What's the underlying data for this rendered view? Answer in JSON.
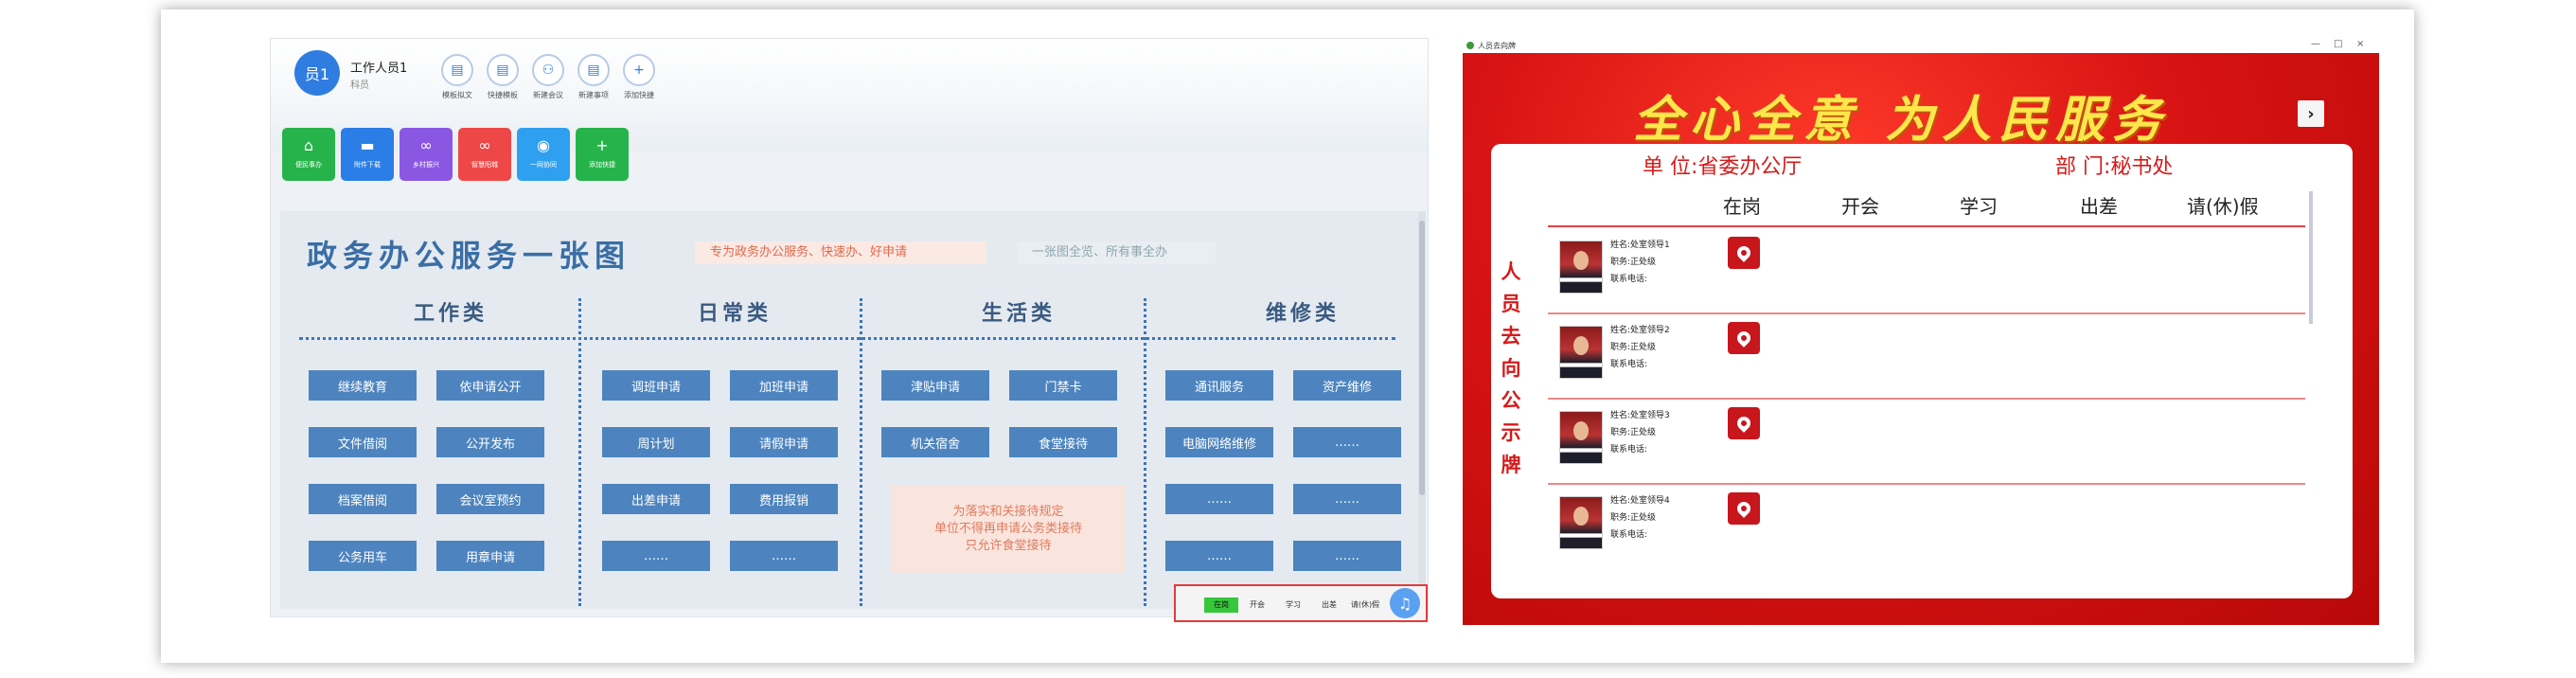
{
  "left": {
    "user": {
      "avatar": "员1",
      "name": "工作人员1",
      "dept": "科员"
    },
    "quick_actions": [
      {
        "label": "模板拟文",
        "icon": "doc-icon"
      },
      {
        "label": "快捷模板",
        "icon": "doc-icon"
      },
      {
        "label": "新建会议",
        "icon": "meeting-icon"
      },
      {
        "label": "新建事项",
        "icon": "doc-icon"
      },
      {
        "label": "添加快捷",
        "icon": "plus-icon"
      }
    ],
    "tiles": [
      {
        "label": "便民事办",
        "color": "#27b34b",
        "icon": "basket-icon"
      },
      {
        "label": "附件下载",
        "color": "#2a7ee6",
        "icon": "folder-icon"
      },
      {
        "label": "乡村振兴",
        "color": "#8a57e3",
        "icon": "link-icon"
      },
      {
        "label": "智慧阳城",
        "color": "#ee4747",
        "icon": "link-icon"
      },
      {
        "label": "一网协同",
        "color": "#2fa0f0",
        "icon": "circle-icon"
      },
      {
        "label": "添加快捷",
        "color": "#27b34b",
        "icon": "plus-icon"
      }
    ],
    "map": {
      "title": "政务办公服务一张图",
      "subtitle": "专为政务办公服务、快速办、好申请",
      "subtitle2": "一张图全览、所有事全办",
      "categories": [
        "工作类",
        "日常类",
        "生活类",
        "维修类"
      ],
      "work": [
        "继续教育",
        "依申请公开",
        "文件借阅",
        "公开发布",
        "档案借阅",
        "会议室预约",
        "公务用车",
        "用章申请"
      ],
      "daily": [
        "调班申请",
        "加班申请",
        "周计划",
        "请假申请",
        "出差申请",
        "费用报销",
        "……",
        "……"
      ],
      "life": [
        "津贴申请",
        "门禁卡",
        "机关宿舍",
        "食堂接待"
      ],
      "life_note": [
        "为落实和关接待规定",
        "单位不得再申请公务类接待",
        "只允许食堂接待"
      ],
      "repair": [
        "通讯服务",
        "资产维修",
        "电脑网络维修",
        "……",
        "……",
        "……",
        "……",
        "……"
      ]
    },
    "status": {
      "items": [
        "在岗",
        "开会",
        "学习",
        "出差",
        "请(休)假"
      ],
      "active": "在岗",
      "bell_icon": "bell-icon"
    }
  },
  "right": {
    "window_title": "人员去向牌",
    "window_buttons": [
      "—",
      "□",
      "×"
    ],
    "slogan": "全心全意 为人民服务",
    "unit": "单 位:省委办公厅",
    "dept": "部 门:秘书处",
    "vertical_label": [
      "人",
      "员",
      "去",
      "向",
      "公",
      "示",
      "牌"
    ],
    "columns": [
      "在岗",
      "开会",
      "学习",
      "出差",
      "请(休)假"
    ],
    "people": [
      {
        "name": "姓名:处室领导1",
        "title": "职务:正处级",
        "phone": "联系电话:",
        "status": "在岗"
      },
      {
        "name": "姓名:处室领导2",
        "title": "职务:正处级",
        "phone": "联系电话:",
        "status": "在岗"
      },
      {
        "name": "姓名:处室领导3",
        "title": "职务:正处级",
        "phone": "联系电话:",
        "status": "在岗"
      },
      {
        "name": "姓名:处室领导4",
        "title": "职务:正处级",
        "phone": "联系电话:",
        "status": "在岗"
      }
    ],
    "next_icon": "chevron-right-icon"
  }
}
